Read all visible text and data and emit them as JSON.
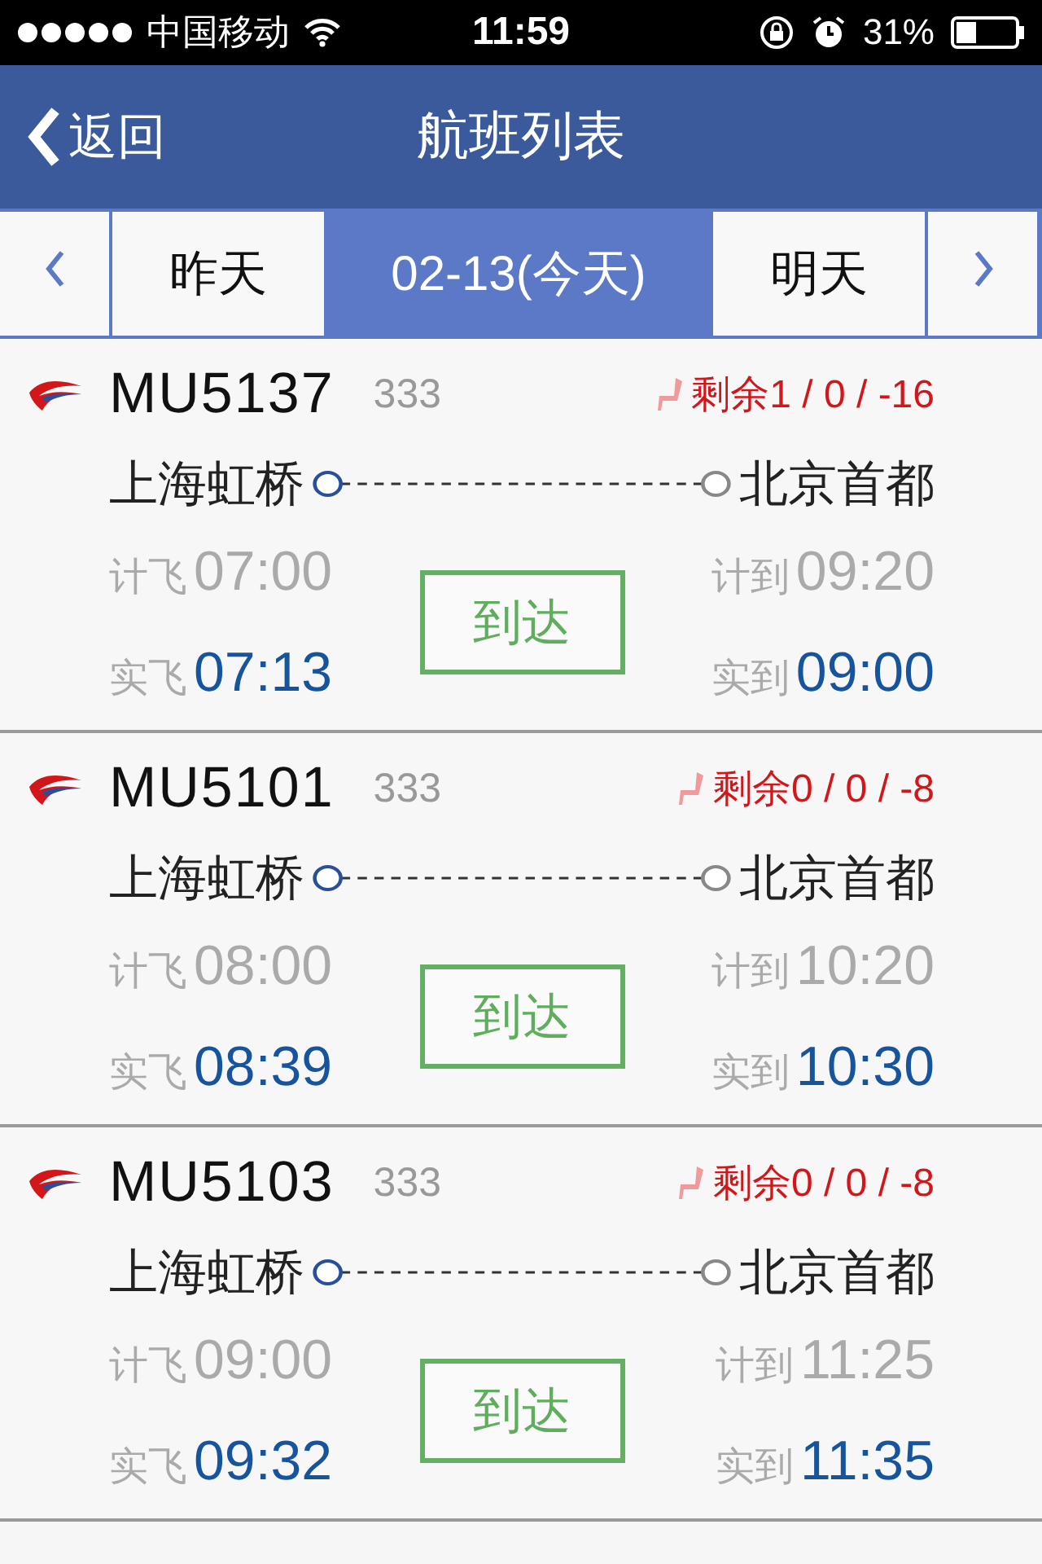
{
  "status_bar": {
    "carrier": "中国移动",
    "time": "11:59",
    "battery": "31%"
  },
  "header": {
    "back": "返回",
    "title": "航班列表"
  },
  "date_tabs": [
    {
      "label": "昨天",
      "selected": false
    },
    {
      "label": "02-13(今天)",
      "selected": true
    },
    {
      "label": "明天",
      "selected": false
    }
  ],
  "flights": [
    {
      "flight_no": "MU5137",
      "aircraft": "333",
      "seats": "剩余1 / 0 / -16",
      "from": "上海虹桥",
      "to": "北京首都",
      "sched_dep_label": "计飞",
      "sched_dep": "07:00",
      "actual_dep_label": "实飞",
      "actual_dep": "07:13",
      "sched_arr_label": "计到",
      "sched_arr": "09:20",
      "actual_arr_label": "实到",
      "actual_arr": "09:00",
      "status": "到达"
    },
    {
      "flight_no": "MU5101",
      "aircraft": "333",
      "seats": "剩余0 / 0 / -8",
      "from": "上海虹桥",
      "to": "北京首都",
      "sched_dep_label": "计飞",
      "sched_dep": "08:00",
      "actual_dep_label": "实飞",
      "actual_dep": "08:39",
      "sched_arr_label": "计到",
      "sched_arr": "10:20",
      "actual_arr_label": "实到",
      "actual_arr": "10:30",
      "status": "到达"
    },
    {
      "flight_no": "MU5103",
      "aircraft": "333",
      "seats": "剩余0 / 0 / -8",
      "from": "上海虹桥",
      "to": "北京首都",
      "sched_dep_label": "计飞",
      "sched_dep": "09:00",
      "actual_dep_label": "实飞",
      "actual_dep": "09:32",
      "sched_arr_label": "计到",
      "sched_arr": "11:25",
      "actual_arr_label": "实到",
      "actual_arr": "11:35",
      "status": "到达"
    }
  ]
}
